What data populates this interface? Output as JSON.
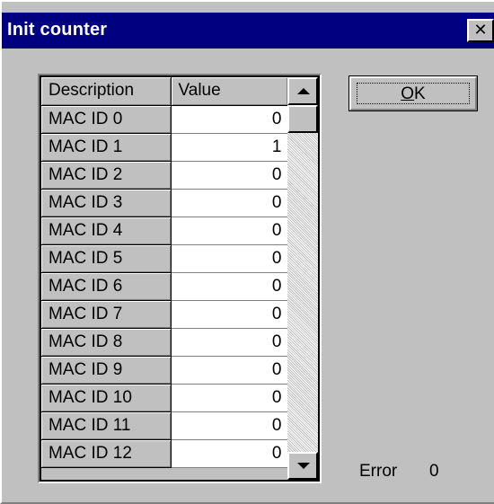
{
  "window": {
    "title": "Init counter",
    "close_glyph": "✕"
  },
  "table": {
    "columns": [
      "Description",
      "Value"
    ],
    "rows": [
      {
        "description": "MAC ID 0",
        "value": "0"
      },
      {
        "description": "MAC ID 1",
        "value": "1"
      },
      {
        "description": "MAC ID 2",
        "value": "0"
      },
      {
        "description": "MAC ID 3",
        "value": "0"
      },
      {
        "description": "MAC ID 4",
        "value": "0"
      },
      {
        "description": "MAC ID 5",
        "value": "0"
      },
      {
        "description": "MAC ID 6",
        "value": "0"
      },
      {
        "description": "MAC ID 7",
        "value": "0"
      },
      {
        "description": "MAC ID 8",
        "value": "0"
      },
      {
        "description": "MAC ID 9",
        "value": "0"
      },
      {
        "description": "MAC ID 10",
        "value": "0"
      },
      {
        "description": "MAC ID 11",
        "value": "0"
      },
      {
        "description": "MAC ID 12",
        "value": "0"
      }
    ]
  },
  "ok_button": {
    "label": "OK",
    "mnemonic": "O",
    "rest": "K"
  },
  "status": {
    "error_label": "Error",
    "error_value": "0"
  },
  "colors": {
    "titlebar": "#000080",
    "face": "#c0c0c0"
  }
}
